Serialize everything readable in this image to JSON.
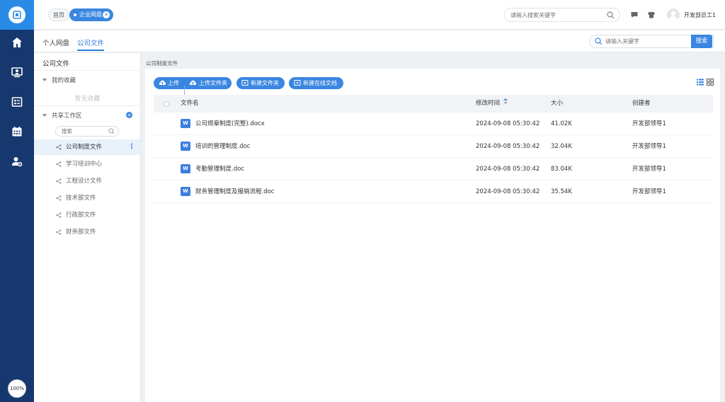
{
  "rail": {
    "items": [
      {
        "name": "home-icon"
      },
      {
        "name": "monitor-user-icon"
      },
      {
        "name": "form-list-icon"
      },
      {
        "name": "calendar-icon"
      },
      {
        "name": "user-settings-icon"
      }
    ],
    "zoom": "100%"
  },
  "topbar": {
    "home_tab": "首页",
    "active_tab": "企业网盘",
    "search_placeholder": "请输入搜索关键字",
    "user_name": "开发部员工1"
  },
  "subbar": {
    "tabs": [
      "个人网盘",
      "公司文件"
    ],
    "active_tab_index": 1,
    "search_placeholder": "请输入关键字",
    "search_button": "搜索"
  },
  "tree": {
    "title": "公司文件",
    "favorites_label": "我的收藏",
    "favorites_empty": "暂无收藏",
    "shared_label": "共享工作区",
    "search_placeholder": "搜索",
    "items": [
      {
        "label": "公司制度文件",
        "active": true
      },
      {
        "label": "学习培训中心"
      },
      {
        "label": "工程设计文件"
      },
      {
        "label": "技术部文件"
      },
      {
        "label": "行政部文件"
      },
      {
        "label": "财务部文件"
      }
    ]
  },
  "main": {
    "breadcrumb": "公司制度文件",
    "buttons": {
      "upload": "上传",
      "upload_folder": "上传文件夹",
      "new_folder": "新建文件夹",
      "new_online_doc": "新建在线文档"
    },
    "columns": {
      "name": "文件名",
      "modified": "修改时间",
      "size": "大小",
      "creator": "创建者"
    },
    "files": [
      {
        "name": "公司规章制度(完整).docx",
        "modified": "2024-09-08 05:30:42",
        "size": "41.02K",
        "creator": "开发部领导1",
        "icon": "W"
      },
      {
        "name": "培训的管理制度.doc",
        "modified": "2024-09-08 05:30:42",
        "size": "32.04K",
        "creator": "开发部领导1",
        "icon": "W"
      },
      {
        "name": "考勤管理制度.doc",
        "modified": "2024-09-08 05:30:42",
        "size": "83.04K",
        "creator": "开发部领导1",
        "icon": "W"
      },
      {
        "name": "财务管理制度及报销流程.doc",
        "modified": "2024-09-08 05:30:42",
        "size": "35.54K",
        "creator": "开发部领导1",
        "icon": "W"
      }
    ]
  },
  "colors": {
    "rail": "#17386e",
    "accent": "#3a86e0",
    "logo_bg": "#2a8be6"
  }
}
